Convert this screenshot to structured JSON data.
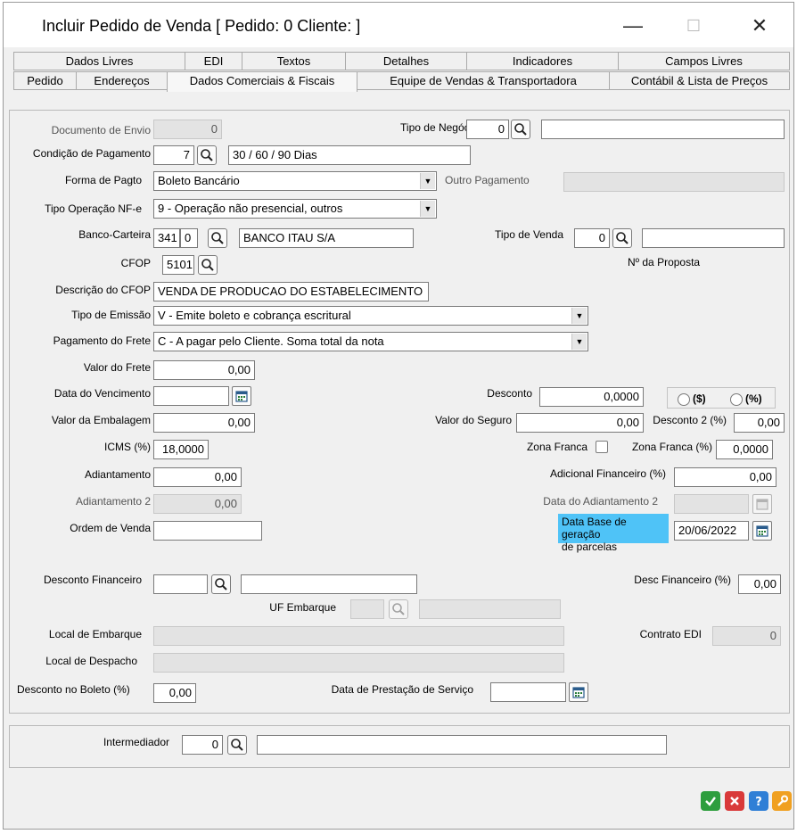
{
  "window": {
    "title": "Incluir Pedido de Venda [ Pedido: 0 Cliente: ]",
    "minimize": "—",
    "maximize": "☐",
    "close": "✕"
  },
  "tabs_row1": [
    "Dados Livres",
    "EDI",
    "Textos",
    "Detalhes",
    "Indicadores",
    "Campos Livres"
  ],
  "tabs_row2": [
    "Pedido",
    "Endereços",
    "Dados Comerciais & Fiscais",
    "Equipe de Vendas & Transportadora",
    "Contábil & Lista de Preços"
  ],
  "form": {
    "documento_envio": {
      "label": "Documento de Envio",
      "value": "0"
    },
    "tipo_negocio": {
      "label": "Tipo de Negócio",
      "value": "0",
      "desc": ""
    },
    "condicao_pagamento": {
      "label": "Condição de Pagamento",
      "value": "7",
      "desc": "30 / 60 / 90 Dias"
    },
    "forma_pagto": {
      "label": "Forma de Pagto",
      "value": "Boleto Bancário"
    },
    "outro_pagamento": {
      "label": "Outro Pagamento",
      "value": ""
    },
    "tipo_operacao": {
      "label": "Tipo Operação NF-e",
      "value": "9 - Operação não presencial, outros"
    },
    "banco_carteira": {
      "label": "Banco-Carteira",
      "banco": "341",
      "carteira": "0",
      "desc": "BANCO ITAU S/A"
    },
    "tipo_venda": {
      "label": "Tipo de Venda",
      "value": "0",
      "desc": ""
    },
    "cfop": {
      "label": "CFOP",
      "value": "5101"
    },
    "num_proposta": {
      "label": "Nº da Proposta"
    },
    "descricao_cfop": {
      "label": "Descrição do CFOP",
      "value": "VENDA DE PRODUCAO DO ESTABELECIMENTO"
    },
    "tipo_emissao": {
      "label": "Tipo de Emissão",
      "value": "V - Emite boleto e cobrança escritural"
    },
    "pagamento_frete": {
      "label": "Pagamento do Frete",
      "value": "C - A pagar pelo Cliente. Soma total da nota"
    },
    "valor_frete": {
      "label": "Valor do Frete",
      "value": "0,00"
    },
    "data_vencimento": {
      "label": "Data do Vencimento",
      "value": ""
    },
    "desconto": {
      "label": "Desconto",
      "value": "0,0000",
      "opt1": "($)",
      "opt2": "(%)"
    },
    "valor_embalagem": {
      "label": "Valor da Embalagem",
      "value": "0,00"
    },
    "valor_seguro": {
      "label": "Valor do Seguro",
      "value": "0,00"
    },
    "desconto2": {
      "label": "Desconto 2 (%)",
      "value": "0,00"
    },
    "icms": {
      "label": "ICMS (%)",
      "value": "18,0000"
    },
    "zona_franca": {
      "label": "Zona Franca"
    },
    "zona_franca_pct": {
      "label": "Zona Franca (%)",
      "value": "0,0000"
    },
    "adiantamento": {
      "label": "Adiantamento",
      "value": "0,00"
    },
    "adicional_financeiro": {
      "label": "Adicional Financeiro (%)",
      "value": "0,00"
    },
    "adiantamento2": {
      "label": "Adiantamento 2",
      "value": "0,00"
    },
    "data_adiantamento2": {
      "label": "Data do Adiantamento 2",
      "value": ""
    },
    "ordem_venda": {
      "label": "Ordem de Venda",
      "value": ""
    },
    "data_base": {
      "label_line1": "Data Base de geração",
      "label_line2": "de parcelas",
      "value": "20/06/2022"
    },
    "desconto_financeiro": {
      "label": "Desconto Financeiro",
      "value": "",
      "desc": ""
    },
    "desc_financeiro_pct": {
      "label": "Desc Financeiro (%)",
      "value": "0,00"
    },
    "uf_embarque": {
      "label": "UF Embarque",
      "value": "",
      "desc": ""
    },
    "local_embarque": {
      "label": "Local de Embarque",
      "value": ""
    },
    "contrato_edi": {
      "label": "Contrato EDI",
      "value": "0"
    },
    "local_despacho": {
      "label": "Local de Despacho",
      "value": ""
    },
    "desconto_boleto": {
      "label": "Desconto no Boleto (%)",
      "value": "0,00"
    },
    "data_prestacao": {
      "label": "Data de Prestação de Serviço",
      "value": ""
    }
  },
  "intermediador": {
    "label": "Intermediador",
    "value": "0",
    "desc": ""
  },
  "colors": {
    "highlight": "#4fc3f7",
    "ok": "#2e9e3e",
    "cancel": "#d93a3a",
    "help": "#2f7fd6",
    "tools": "#f0a020"
  }
}
